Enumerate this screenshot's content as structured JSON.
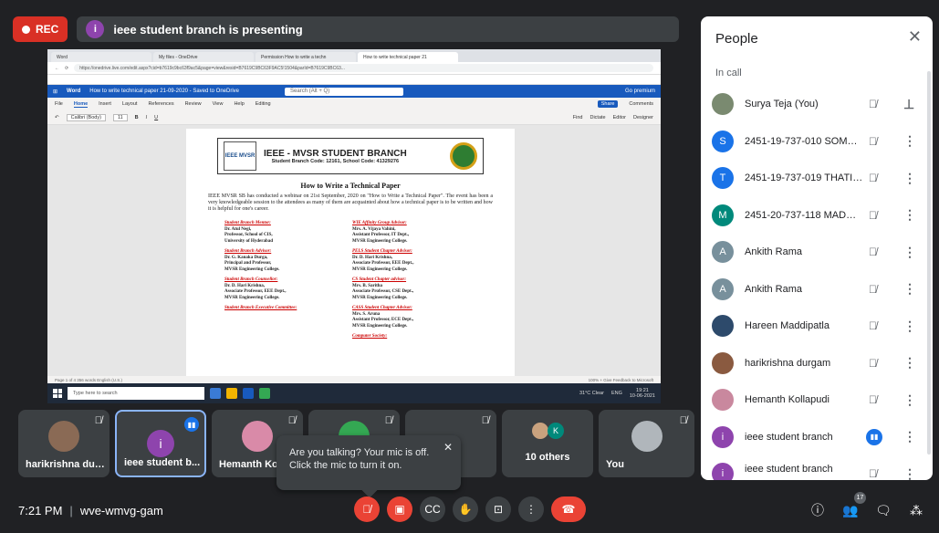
{
  "topbar": {
    "rec_label": "REC",
    "presenter_initial": "i",
    "presenting_text": "ieee student branch is presenting"
  },
  "presentation": {
    "browser_tabs": [
      "Word",
      "My files - OneDrive",
      "Permission How to write a techn",
      "How to write technical paper 21"
    ],
    "url": "https://onedrive.live.com/edit.aspx?cid=b7619c9bc63f9ac5&page=view&resid=B7619C9BC63F9AC5!1504&parId=B7619C9BC63...",
    "word_app": "Word",
    "doc_name": "How to write technical paper 21-09-2020 - Saved to OneDrive",
    "search_placeholder": "Search (Alt + Q)",
    "go_premium": "Go premium",
    "ribbon_tabs": [
      "File",
      "Home",
      "Insert",
      "Layout",
      "References",
      "Review",
      "View",
      "Help",
      "Editing"
    ],
    "share": "Share",
    "comments": "Comments",
    "font_name": "Calibri (Body)",
    "font_size": "11",
    "ribbon_right": [
      "Find",
      "Dictate",
      "Editor",
      "Designer"
    ],
    "header_title": "IEEE - MVSR STUDENT BRANCH",
    "header_sub": "Student Branch Code: 12161, School Code: 41329276",
    "logo_text": "IEEE MVSR",
    "doc_title": "How to Write a Technical Paper",
    "doc_para": "IEEE MVSR SB has conducted a webinar on 21st September, 2020 on \"How to Write a Technical Paper\". The event has been a very knowledgeable session to the attendees as many of them are acquainted about how a technical paper is to be written and how it is helpful for one's career.",
    "left_col": [
      {
        "title": "Student Branch Mentor:",
        "lines": [
          "Dr. Atul Negi,",
          "Professor, School of CIS,",
          "University of Hyderabad"
        ]
      },
      {
        "title": "Student Branch Advisor:",
        "lines": [
          "Dr. G. Kanaka Durga,",
          "Principal and Professor,",
          "MVSR Engineering College."
        ]
      },
      {
        "title": "Student Branch Counsellor:",
        "lines": [
          "Dr. D. Hari Krishna,",
          "Associate Professor, EEE Dept.,",
          "MVSR Engineering College."
        ]
      },
      {
        "title": "Student Branch Executive Committee:",
        "lines": []
      }
    ],
    "right_col": [
      {
        "title": "WIE Affinity Group Advisor:",
        "lines": [
          "Mrs. A. Vijaya Vahini,",
          "Assistant Professor, IT Dept.,",
          "MVSR Engineering College."
        ]
      },
      {
        "title": "PELS Student Chapter Advisor:",
        "lines": [
          "Dr. D. Hari Krishna,",
          "Associate Professor, EEE Dept.,",
          "MVSR Engineering College."
        ]
      },
      {
        "title": "CS Student Chapter advisor:",
        "lines": [
          "Mrs. B. Saritha",
          "Associate Professor, CSE Dept.,",
          "MVSR Engineering College."
        ]
      },
      {
        "title": "CASS Student Chapter Advisor:",
        "lines": [
          "Mrs. S. Aruna",
          "Assistant Professor, ECE Dept.,",
          "MVSR Engineering College."
        ]
      },
      {
        "title": "Computer Society:",
        "lines": []
      }
    ],
    "status_left": "Page 1 of 4    356 words    English (U.S.)",
    "status_right": "100%   +   Give Feedback to Microsoft",
    "taskbar_search": "Type here to search",
    "weather": "31°C Clear",
    "lang": "ENG",
    "tray_time": "19:21",
    "tray_date": "10-06-2021"
  },
  "tiles": [
    {
      "name": "harikrishna dur...",
      "muted": true
    },
    {
      "name": "ieee student b...",
      "initial": "i",
      "speaking": true
    },
    {
      "name": "Hemanth Ko",
      "muted": true
    },
    {
      "name": "",
      "muted": true
    },
    {
      "name": "",
      "muted": true
    },
    {
      "center": "10 others",
      "initial": "K"
    },
    {
      "name": "You",
      "muted": true
    }
  ],
  "tooltip": {
    "line1": "Are you talking? Your mic is off.",
    "line2": "Click the mic to turn it on."
  },
  "bottom": {
    "time": "7:21 PM",
    "separator": "|",
    "meeting_code": "wve-wmvg-gam",
    "people_count": "17"
  },
  "panel": {
    "title": "People",
    "section": "In call",
    "people": [
      {
        "name": "Surya Teja (You)",
        "avatar": "photo",
        "right": "pin"
      },
      {
        "name": "2451-19-737-010 SOMAR...",
        "initial": "S",
        "color": "#1a73e8"
      },
      {
        "name": "2451-19-737-019 THATI RI...",
        "initial": "T",
        "color": "#1a73e8"
      },
      {
        "name": "2451-20-737-118 MADUM...",
        "initial": "M",
        "color": "#00897b"
      },
      {
        "name": "Ankith Rama",
        "initial": "A",
        "color": "#78909c"
      },
      {
        "name": "Ankith Rama",
        "initial": "A",
        "color": "#78909c"
      },
      {
        "name": "Hareen Maddipatla",
        "avatar": "photo"
      },
      {
        "name": "harikrishna durgam",
        "avatar": "photo"
      },
      {
        "name": "Hemanth Kollapudi",
        "avatar": "photo"
      },
      {
        "name": "ieee student branch",
        "initial": "i",
        "color": "#8e44ad",
        "speaking": true
      },
      {
        "name": "ieee student branch",
        "sub": "Presentation",
        "initial": "i",
        "color": "#8e44ad"
      }
    ]
  },
  "colors": {
    "background": "#202124",
    "tile": "#3c4043",
    "rec": "#d93025",
    "accent": "#1a73e8",
    "hangup": "#ea4335"
  }
}
